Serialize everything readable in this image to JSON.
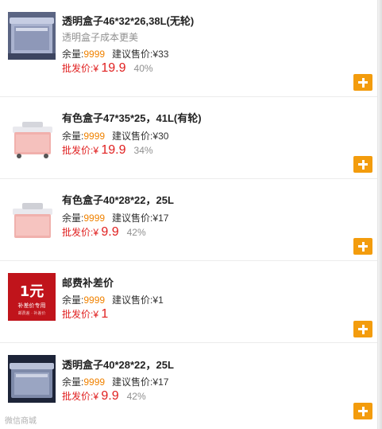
{
  "labels": {
    "stock_label": "余量:",
    "suggest_label": "建议售价:",
    "wholesale_label": "批发价:"
  },
  "products": [
    {
      "title": "透明盒子46*32*26,38L(无轮)",
      "subtitle": "透明盒子成本更美",
      "stock": "9999",
      "suggested_price": "¥33",
      "currency": "¥",
      "wholesale_price": "19.9",
      "discount": "40%",
      "image": "transparent-box-image"
    },
    {
      "title": "有色盒子47*35*25，41L(有轮)",
      "stock": "9999",
      "suggested_price": "¥30",
      "currency": "¥",
      "wholesale_price": "19.9",
      "discount": "34%",
      "image": "pink-box-image"
    },
    {
      "title": "有色盒子40*28*22，25L",
      "stock": "9999",
      "suggested_price": "¥17",
      "currency": "¥",
      "wholesale_price": "9.9",
      "discount": "42%",
      "image": "pink-box-image"
    },
    {
      "title": "邮费补差价",
      "stock": "9999",
      "suggested_price": "¥1",
      "currency": "¥",
      "wholesale_price": "1",
      "discount": "",
      "image": "postage-badge-image",
      "badge_big": "1元",
      "badge_line1": "补差价专用",
      "badge_line2": "邮费差 · 补差价"
    },
    {
      "title": "透明盒子40*28*22，25L",
      "stock": "9999",
      "suggested_price": "¥17",
      "currency": "¥",
      "wholesale_price": "9.9",
      "discount": "42%",
      "image": "transparent-box-image"
    }
  ],
  "watermark": "微信商城"
}
